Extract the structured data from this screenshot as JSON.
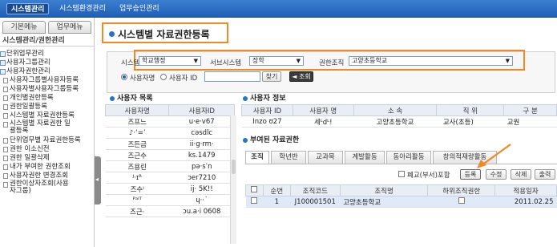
{
  "topbar": {
    "menus": [
      "시스템관리",
      "시스템환경관리",
      "업무승인관리"
    ]
  },
  "sidebar": {
    "tabs": [
      "기본메뉴",
      "업무메뉴"
    ],
    "title": "시스템관리/권한관리",
    "items": [
      {
        "label": "단위업무관리",
        "level": 0
      },
      {
        "label": "사용자그룹관리",
        "level": 0
      },
      {
        "label": "사용자권한관리",
        "level": 0
      },
      {
        "label": "사용자그룹별사용자등록",
        "level": 1
      },
      {
        "label": "사용자별사용자그룹등록",
        "level": 1
      },
      {
        "label": "개인별권한등록",
        "level": 1
      },
      {
        "label": "권한일괄등록",
        "level": 1
      },
      {
        "label": "시스템별 자료권한등록",
        "level": 1
      },
      {
        "label": "시스템별 자료권한 일괄등록",
        "level": 1
      },
      {
        "label": "단위업무별 자료권한등록",
        "level": 1
      },
      {
        "label": "권한 이소신전",
        "level": 1
      },
      {
        "label": "권한 일괄삭제",
        "level": 1
      },
      {
        "label": "내가 부여한 권한조회",
        "level": 1
      },
      {
        "label": "사용자권한 변경조회",
        "level": 1
      },
      {
        "label": "권한이상자조회(사용자그룹)",
        "level": 1
      }
    ]
  },
  "page": {
    "title": "시스템별 자료권한등록"
  },
  "search": {
    "system_label": "시스템",
    "system_value": "학교행정",
    "subsystem_label": "서브시스템",
    "subsystem_value": "장학",
    "org_label": "권한조직",
    "org_value": "고양초등학교",
    "radio_name": "사용자명",
    "radio_id": "사용자 ID",
    "find_button": "찾기",
    "query_button": "조회"
  },
  "user_list": {
    "title": "사용자 목록",
    "columns": [
      "사용자명",
      "사용자ID"
    ],
    "rows": [
      [
        "즈프느",
        "u·e·v67"
      ],
      [
        "♪·ʻ=ʼ",
        "cəsdlc"
      ],
      [
        "즈든금",
        "ii·g·rm·"
      ],
      [
        "즈근수",
        "ks.1479"
      ],
      [
        "즈용린",
        "pə·sˈn"
      ],
      [
        "ᴶ·ɪᴿ",
        "ɔer7210"
      ],
      [
        "즈수ᴵ",
        "ij· 5K!!"
      ],
      [
        "ᴾᵃᴵᵀ",
        "ɥ··˙"
      ],
      [
        "즈근·",
        "ɔu.a·i 0608"
      ]
    ]
  },
  "user_info": {
    "title": "사용자 정보",
    "columns": [
      "사용자 ID",
      "사용자 명",
      "소 속",
      "직 위",
      "구 분"
    ],
    "row": [
      "Inzo ʊ27",
      "세ᴸdᴸ!",
      "고양초등학교",
      "교사(초등)",
      "교원"
    ]
  },
  "granted": {
    "title": "부여된 자료권한",
    "tabs": [
      "조직",
      "학년반",
      "교과목",
      "계발활동",
      "동아리활동",
      "창의적재량활동"
    ],
    "active_tab": 0,
    "include_closed_label": "폐교(부서)포함",
    "buttons": [
      "등록",
      "수정",
      "삭제",
      "출력"
    ],
    "columns": [
      "",
      "순번",
      "조직코드",
      "조직명",
      "하위조직권한",
      "적용일자"
    ],
    "rows": [
      {
        "no": "1",
        "code": "J100001501",
        "name": "고양초등학교",
        "date": "2011.02.25"
      }
    ]
  }
}
